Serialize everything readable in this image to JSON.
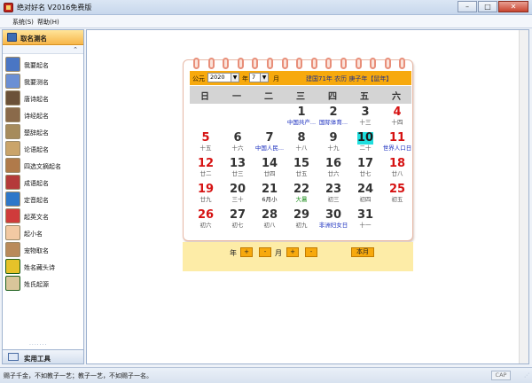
{
  "window": {
    "title": "绝对好名 V2016免费版",
    "min": "–",
    "max": "□",
    "close": "✕"
  },
  "menu": [
    "系统(S)",
    "帮助(H)"
  ],
  "sidebar": {
    "header": "取名测名",
    "collapse": "⌃",
    "items": [
      {
        "label": "我要起名",
        "color": "#4a76c4"
      },
      {
        "label": "我要测名",
        "color": "#6b8fd4"
      },
      {
        "label": "唐诗起名",
        "color": "#6b5138"
      },
      {
        "label": "诗经起名",
        "color": "#8a6a4a"
      },
      {
        "label": "楚辞起名",
        "color": "#a68b5c"
      },
      {
        "label": "论语起名",
        "color": "#caa46a"
      },
      {
        "label": "四选文摘起名",
        "color": "#b07a4a"
      },
      {
        "label": "成语起名",
        "color": "#b43a3a"
      },
      {
        "label": "定音起名",
        "color": "#2d77c9"
      },
      {
        "label": "起英文名",
        "color": "#cf3b3b"
      },
      {
        "label": "起小名",
        "color": "#f2c9a3"
      },
      {
        "label": "宠物取名",
        "color": "#b98a5a"
      },
      {
        "label": "姓名藏头诗",
        "color": "#e6c229"
      },
      {
        "label": "姓氏起源",
        "color": "#d9c59a"
      }
    ],
    "footer": "实用工具"
  },
  "calendar": {
    "gongyuan": "公元",
    "year_value": "2020",
    "year_suffix": "年",
    "month_value": "7",
    "month_suffix": "月",
    "info": "建国71年  农历 庚子年【鼠年】",
    "weekdays": [
      "日",
      "一",
      "二",
      "三",
      "四",
      "五",
      "六"
    ],
    "weeks": [
      [
        null,
        null,
        null,
        {
          "n": "1",
          "s": "中国共产...",
          "st": "blue"
        },
        {
          "n": "2",
          "s": "国际体育...",
          "st": "blue"
        },
        {
          "n": "3",
          "s": "十三"
        },
        {
          "n": "4",
          "s": "十四",
          "red": true
        }
      ],
      [
        {
          "n": "5",
          "s": "十五",
          "red": true
        },
        {
          "n": "6",
          "s": "十六"
        },
        {
          "n": "7",
          "s": "中国人民...",
          "st": "blue"
        },
        {
          "n": "8",
          "s": "十八"
        },
        {
          "n": "9",
          "s": "十九"
        },
        {
          "n": "10",
          "s": "二十",
          "today": true
        },
        {
          "n": "11",
          "s": "世界人口日",
          "st": "blue",
          "red": true
        }
      ],
      [
        {
          "n": "12",
          "s": "廿二",
          "red": true
        },
        {
          "n": "13",
          "s": "廿三"
        },
        {
          "n": "14",
          "s": "廿四"
        },
        {
          "n": "15",
          "s": "廿五"
        },
        {
          "n": "16",
          "s": "廿六"
        },
        {
          "n": "17",
          "s": "廿七"
        },
        {
          "n": "18",
          "s": "廿八",
          "red": true
        }
      ],
      [
        {
          "n": "19",
          "s": "廿九",
          "red": true
        },
        {
          "n": "20",
          "s": "三十"
        },
        {
          "n": "21",
          "s": "6月小",
          "st": "dark"
        },
        {
          "n": "22",
          "s": "大暑",
          "st": "green"
        },
        {
          "n": "23",
          "s": "初三"
        },
        {
          "n": "24",
          "s": "初四"
        },
        {
          "n": "25",
          "s": "初五",
          "red": true
        }
      ],
      [
        {
          "n": "26",
          "s": "初六",
          "red": true
        },
        {
          "n": "27",
          "s": "初七"
        },
        {
          "n": "28",
          "s": "初八"
        },
        {
          "n": "29",
          "s": "初九"
        },
        {
          "n": "30",
          "s": "非洲妇女日",
          "st": "blue"
        },
        {
          "n": "31",
          "s": "十一"
        },
        null
      ]
    ],
    "footer": {
      "year": "年",
      "plus": "+",
      "minus": "-",
      "month": "月",
      "this_month": "本月"
    }
  },
  "status": {
    "text": "赐子千金，不如教子一艺；教子一艺，不如赐子一名。",
    "cap": "CAP"
  },
  "colors": {
    "accent": "#f7a90d",
    "today": "#1fdede",
    "holiday": "#d61313",
    "festival": "#1b2fbf"
  }
}
